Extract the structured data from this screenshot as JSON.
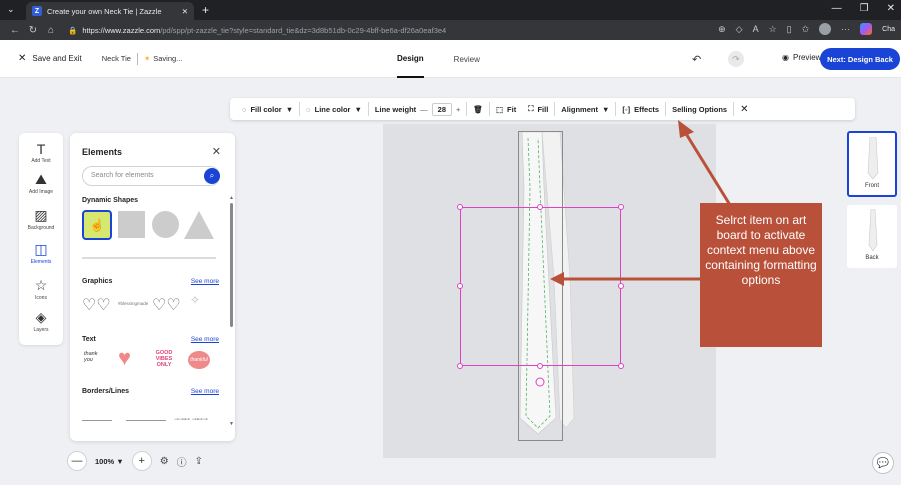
{
  "browser": {
    "tab_title": "Create your own Neck Tie | Zazzle",
    "favicon": "Z",
    "url_host": "https://www.zazzle.com",
    "url_path": "/pd/spp/pt-zazzle_tie?style=standard_tie&dz=3d8b51db-0c29-4bff-be6a-df26a0eaf3e4",
    "copilot_label": "Cha"
  },
  "header": {
    "save_exit": "Save and Exit",
    "doc_name": "Neck Tie",
    "saving": "Saving...",
    "tabs": [
      "Design",
      "Review"
    ],
    "preview": "Preview",
    "next": "Next: Design Back"
  },
  "context_toolbar": {
    "fill_color": "Fill color",
    "line_color": "Line color",
    "line_weight": "Line weight",
    "line_weight_value": "28",
    "fit": "Fit",
    "fill": "Fill",
    "alignment": "Alignment",
    "effects": "Effects",
    "selling_options": "Selling Options"
  },
  "rail": {
    "items": [
      "Add Text",
      "Add Image",
      "Background",
      "Elements",
      "Icons",
      "Layers"
    ],
    "active": "Elements"
  },
  "panel": {
    "title": "Elements",
    "search_placeholder": "Search for elements",
    "dynamic_shapes": "Dynamic Shapes",
    "graphics": "Graphics",
    "text": "Text",
    "borders": "Borders/Lines",
    "see_more": "See more",
    "sticker_thank": "thank you",
    "sticker_good": "GOOD VIBES ONLY",
    "sticker_thankful": "thankful",
    "graphic_script": "#blessingmade"
  },
  "callout": {
    "text": "Selrct item on art board to activate context menu above containing formatting options",
    "color": "#b9503a"
  },
  "thumbnails": [
    "Front",
    "Back"
  ],
  "bottom": {
    "zoom": "100%"
  },
  "colors": {
    "accent": "#1944d6",
    "selection": "#e040c8"
  }
}
